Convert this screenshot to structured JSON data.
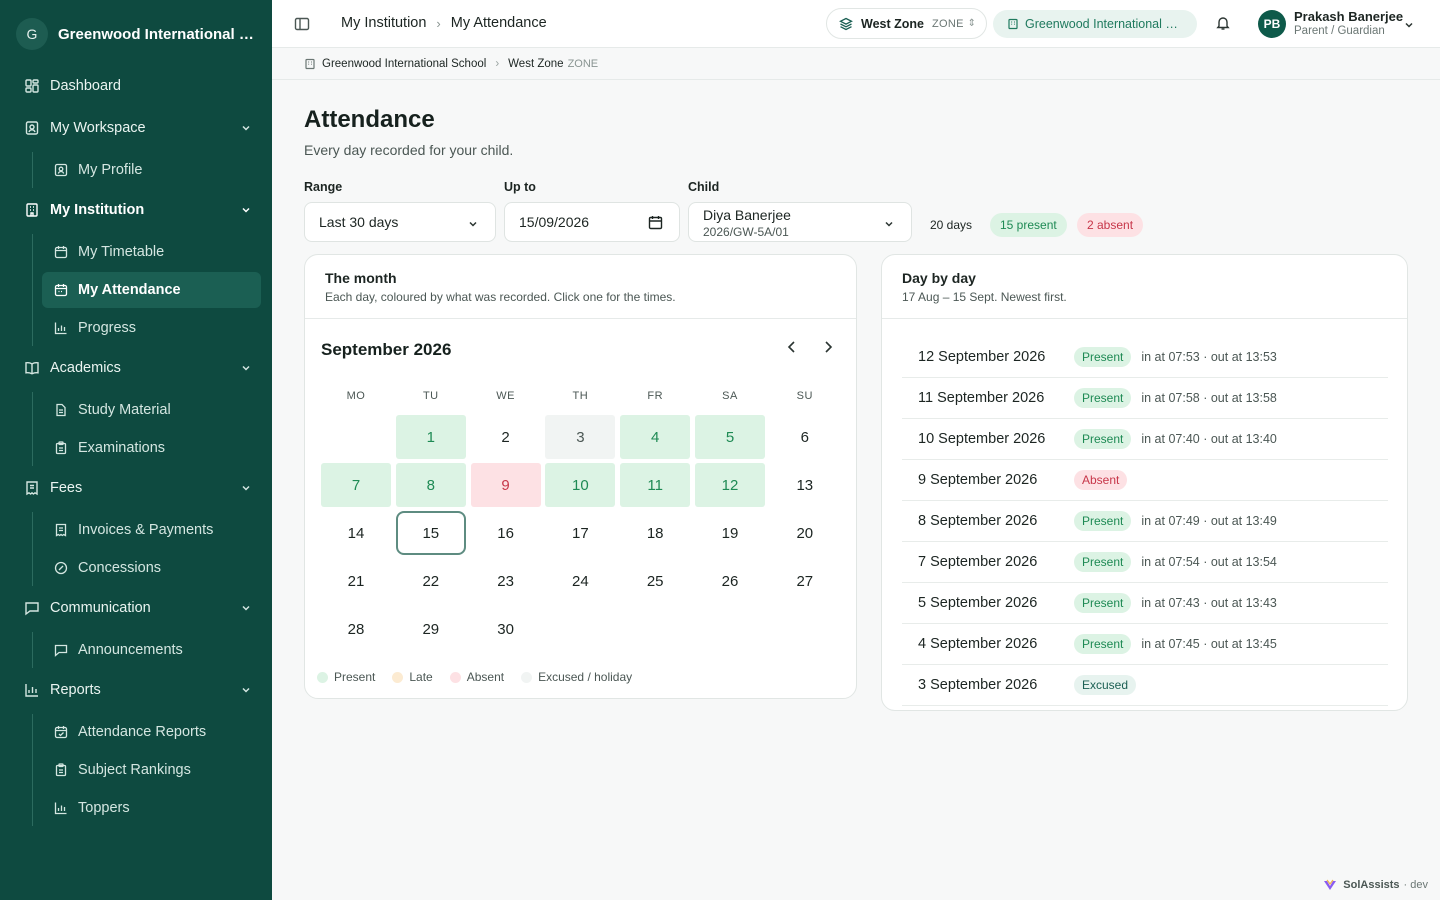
{
  "sidebar": {
    "org_initial": "G",
    "org_name": "Greenwood International School",
    "items": [
      {
        "label": "Dashboard"
      },
      {
        "label": "My Workspace"
      },
      {
        "label": "My Profile"
      },
      {
        "label": "My Institution"
      },
      {
        "label": "My Timetable"
      },
      {
        "label": "My Attendance"
      },
      {
        "label": "Progress"
      },
      {
        "label": "Academics"
      },
      {
        "label": "Study Material"
      },
      {
        "label": "Examinations"
      },
      {
        "label": "Fees"
      },
      {
        "label": "Invoices & Payments"
      },
      {
        "label": "Concessions"
      },
      {
        "label": "Communication"
      },
      {
        "label": "Announcements"
      },
      {
        "label": "Reports"
      },
      {
        "label": "Attendance Reports"
      },
      {
        "label": "Subject Rankings"
      },
      {
        "label": "Toppers"
      }
    ]
  },
  "topbar": {
    "crumb1": "My Institution",
    "crumb2": "My Attendance",
    "zone_name": "West Zone",
    "zone_tag": "ZONE",
    "school": "Greenwood International School",
    "user_initials": "PB",
    "user_name": "Prakash Banerjee",
    "user_role": "Parent / Guardian"
  },
  "breadcrumb": {
    "school": "Greenwood International School",
    "zone": "West Zone",
    "zone_tag": "ZONE"
  },
  "page": {
    "title": "Attendance",
    "subtitle": "Every day recorded for your child."
  },
  "filters": {
    "range_label": "Range",
    "range_value": "Last 30 days",
    "upto_label": "Up to",
    "upto_value": "15/09/2026",
    "child_label": "Child",
    "child_name": "Diya Banerjee",
    "child_id": "2026/GW-5A/01"
  },
  "summary": {
    "days": "20 days",
    "present": "15 present",
    "absent": "2 absent"
  },
  "month_card": {
    "title": "The month",
    "subtitle": "Each day, coloured by what was recorded. Click one for the times.",
    "month_label": "September 2026",
    "dow": [
      "MO",
      "TU",
      "WE",
      "TH",
      "FR",
      "SA",
      "SU"
    ],
    "days": [
      {
        "n": "",
        "s": "empty"
      },
      {
        "n": "1",
        "s": "present"
      },
      {
        "n": "2",
        "s": "none"
      },
      {
        "n": "3",
        "s": "excused"
      },
      {
        "n": "4",
        "s": "present"
      },
      {
        "n": "5",
        "s": "present"
      },
      {
        "n": "6",
        "s": "none"
      },
      {
        "n": "7",
        "s": "present"
      },
      {
        "n": "8",
        "s": "present"
      },
      {
        "n": "9",
        "s": "absent"
      },
      {
        "n": "10",
        "s": "present"
      },
      {
        "n": "11",
        "s": "present"
      },
      {
        "n": "12",
        "s": "present"
      },
      {
        "n": "13",
        "s": "none"
      },
      {
        "n": "14",
        "s": "none"
      },
      {
        "n": "15",
        "s": "today"
      },
      {
        "n": "16",
        "s": "none"
      },
      {
        "n": "17",
        "s": "none"
      },
      {
        "n": "18",
        "s": "none"
      },
      {
        "n": "19",
        "s": "none"
      },
      {
        "n": "20",
        "s": "none"
      },
      {
        "n": "21",
        "s": "none"
      },
      {
        "n": "22",
        "s": "none"
      },
      {
        "n": "23",
        "s": "none"
      },
      {
        "n": "24",
        "s": "none"
      },
      {
        "n": "25",
        "s": "none"
      },
      {
        "n": "26",
        "s": "none"
      },
      {
        "n": "27",
        "s": "none"
      },
      {
        "n": "28",
        "s": "none"
      },
      {
        "n": "29",
        "s": "none"
      },
      {
        "n": "30",
        "s": "none"
      }
    ],
    "legend": [
      {
        "label": "Present",
        "color": "#dcf3e4"
      },
      {
        "label": "Late",
        "color": "#fcebd2"
      },
      {
        "label": "Absent",
        "color": "#fde1e4"
      },
      {
        "label": "Excused / holiday",
        "color": "#f1f4f3"
      }
    ]
  },
  "day_card": {
    "title": "Day by day",
    "subtitle": "17 Aug – 15 Sept. Newest first.",
    "rows": [
      {
        "date": "12 September 2026",
        "status": "Present",
        "times": "in at 07:53 · out at 13:53"
      },
      {
        "date": "11 September 2026",
        "status": "Present",
        "times": "in at 07:58 · out at 13:58"
      },
      {
        "date": "10 September 2026",
        "status": "Present",
        "times": "in at 07:40 · out at 13:40"
      },
      {
        "date": "9 September 2026",
        "status": "Absent",
        "times": ""
      },
      {
        "date": "8 September 2026",
        "status": "Present",
        "times": "in at 07:49 · out at 13:49"
      },
      {
        "date": "7 September 2026",
        "status": "Present",
        "times": "in at 07:54 · out at 13:54"
      },
      {
        "date": "5 September 2026",
        "status": "Present",
        "times": "in at 07:43 · out at 13:43"
      },
      {
        "date": "4 September 2026",
        "status": "Present",
        "times": "in at 07:45 · out at 13:45"
      },
      {
        "date": "3 September 2026",
        "status": "Excused",
        "times": ""
      }
    ]
  },
  "footer": {
    "brand": "SolAssists",
    "env": "· dev"
  },
  "colors": {
    "sidebar": "#0e4a40",
    "present": "#1e8a54",
    "absent": "#c73649"
  }
}
